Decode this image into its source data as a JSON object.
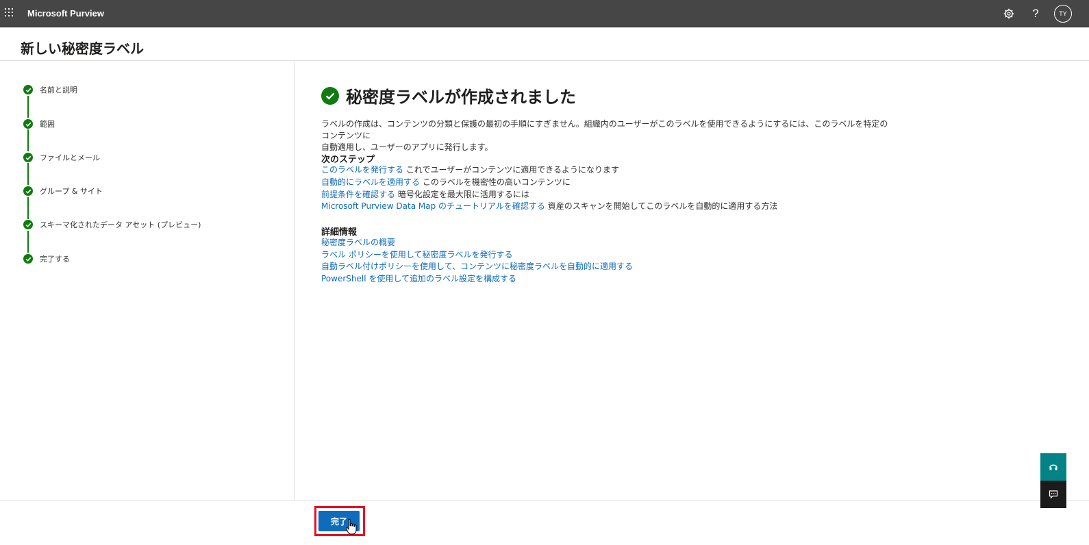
{
  "topbar": {
    "app_title": "Microsoft Purview",
    "avatar_initials": "TY",
    "help_glyph": "?",
    "icons": [
      "app-launcher-icon",
      "gear-icon",
      "help-icon"
    ]
  },
  "page": {
    "title": "新しい秘密度ラベル"
  },
  "steps": [
    {
      "label": "名前と説明"
    },
    {
      "label": "範囲"
    },
    {
      "label": "ファイルとメール"
    },
    {
      "label": "グループ & サイト"
    },
    {
      "label": "スキーマ化されたデータ アセット (プレビュー)"
    },
    {
      "label": "完了する"
    }
  ],
  "main": {
    "success_title": "秘密度ラベルが作成されました",
    "intro_line1": "ラベルの作成は、コンテンツの分類と保護の最初の手順にすぎません。組織内のユーザーがこのラベルを使用できるようにするには、このラベルを特定のコンテンツに",
    "intro_line2": "自動適用し、ユーザーのアプリに発行します。",
    "next_steps_heading": "次のステップ",
    "next_steps": [
      {
        "link": "このラベルを発行する",
        "text": " これでユーザーがコンテンツに適用できるようになります"
      },
      {
        "link": "自動的にラベルを適用する",
        "text": " このラベルを機密性の高いコンテンツに"
      },
      {
        "link": "前提条件を確認する",
        "text": " 暗号化設定を最大限に活用するには"
      },
      {
        "link": "Microsoft Purview Data Map のチュートリアルを確認する",
        "text": " 資産のスキャンを開始してこのラベルを自動的に適用する方法"
      }
    ],
    "details_heading": "詳細情報",
    "details": [
      {
        "link": "秘密度ラベルの概要"
      },
      {
        "link": "ラベル ポリシーを使用して秘密度ラベルを発行する"
      },
      {
        "link": "自動ラベル付けポリシーを使用して、コンテンツに秘密度ラベルを自動的に適用する"
      },
      {
        "link": "PowerShell を使用して追加のラベル設定を構成する"
      }
    ]
  },
  "footer": {
    "done_label": "完了"
  },
  "colors": {
    "topbar": "#464646",
    "accent": "#0f6cbd",
    "success": "#107c10",
    "highlight": "#e81123"
  }
}
